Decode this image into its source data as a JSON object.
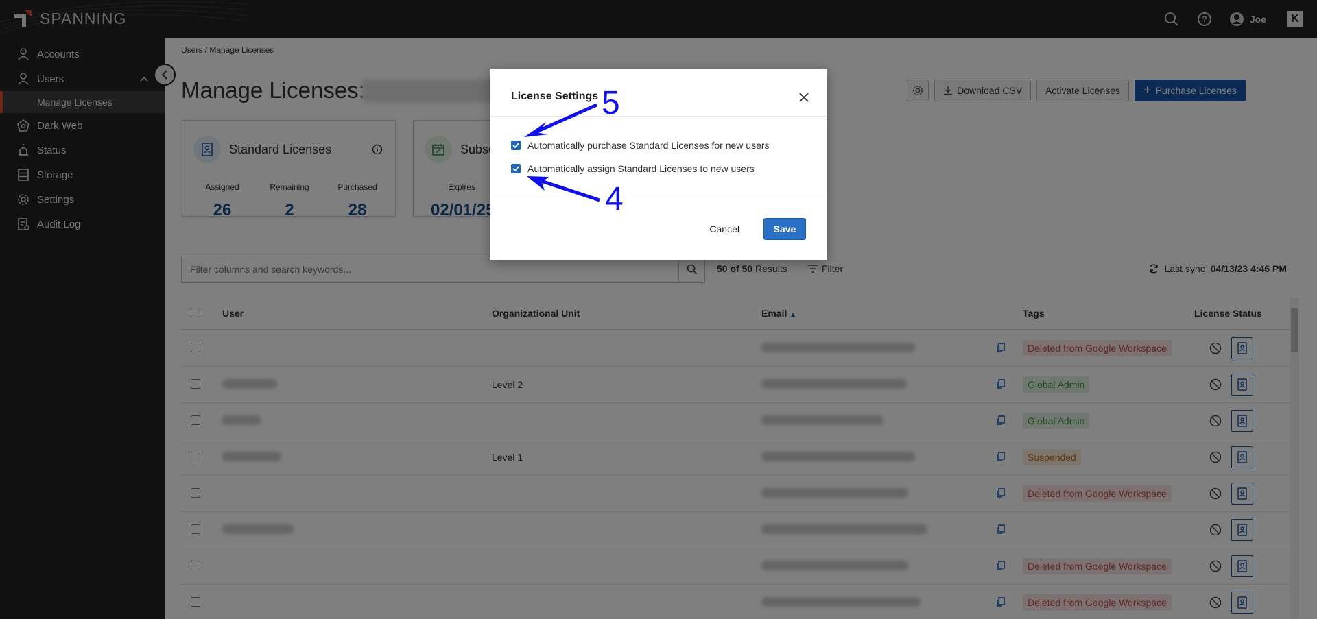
{
  "topbar": {
    "brand": "SPANNING",
    "user": "Joe"
  },
  "sidebar": {
    "items": [
      {
        "label": "Accounts"
      },
      {
        "label": "Users"
      },
      {
        "label": "Manage Licenses"
      },
      {
        "label": "Dark Web"
      },
      {
        "label": "Status"
      },
      {
        "label": "Storage"
      },
      {
        "label": "Settings"
      },
      {
        "label": "Audit Log"
      }
    ]
  },
  "page": {
    "breadcrumb": "Users / Manage Licenses",
    "title": "Manage Licenses:",
    "actions": {
      "download": "Download CSV",
      "activate": "Activate Licenses",
      "purchase": "Purchase Licenses"
    }
  },
  "cards": {
    "standard": {
      "title": "Standard Licenses",
      "assigned_label": "Assigned",
      "assigned": "26",
      "remaining_label": "Remaining",
      "remaining": "2",
      "purchased_label": "Purchased",
      "purchased": "28"
    },
    "subscription": {
      "title": "Subsc",
      "expires_label": "Expires",
      "expires": "02/01/25"
    }
  },
  "search": {
    "placeholder": "Filter columns and search keywords..."
  },
  "results": {
    "count": "50 of 50",
    "label": "Results"
  },
  "filter_label": "Filter",
  "sync": {
    "label": "Last sync",
    "value": "04/13/23 4:46 PM"
  },
  "table": {
    "columns": {
      "user": "User",
      "org": "Organizational Unit",
      "email": "Email",
      "tags": "Tags",
      "status": "License Status"
    },
    "rows": [
      {
        "org": "",
        "tag": "Deleted from Google Workspace"
      },
      {
        "org": "Level 2",
        "tag": "Global Admin"
      },
      {
        "org": "",
        "tag": "Global Admin"
      },
      {
        "org": "Level 1",
        "tag": "Suspended"
      },
      {
        "org": "",
        "tag": "Deleted from Google Workspace"
      },
      {
        "org": "",
        "tag": ""
      },
      {
        "org": "",
        "tag": "Deleted from Google Workspace"
      },
      {
        "org": "",
        "tag": "Deleted from Google Workspace"
      }
    ]
  },
  "modal": {
    "title": "License Settings",
    "option1": "Automatically purchase Standard Licenses for new users",
    "option2": "Automatically assign Standard Licenses to new users",
    "cancel": "Cancel",
    "save": "Save"
  },
  "annotations": {
    "five": "5",
    "four": "4"
  },
  "colors": {
    "accent": "#1656a8",
    "sidebar": "#232323",
    "active_marker": "#e04a2f",
    "annotation": "#1010e8"
  }
}
